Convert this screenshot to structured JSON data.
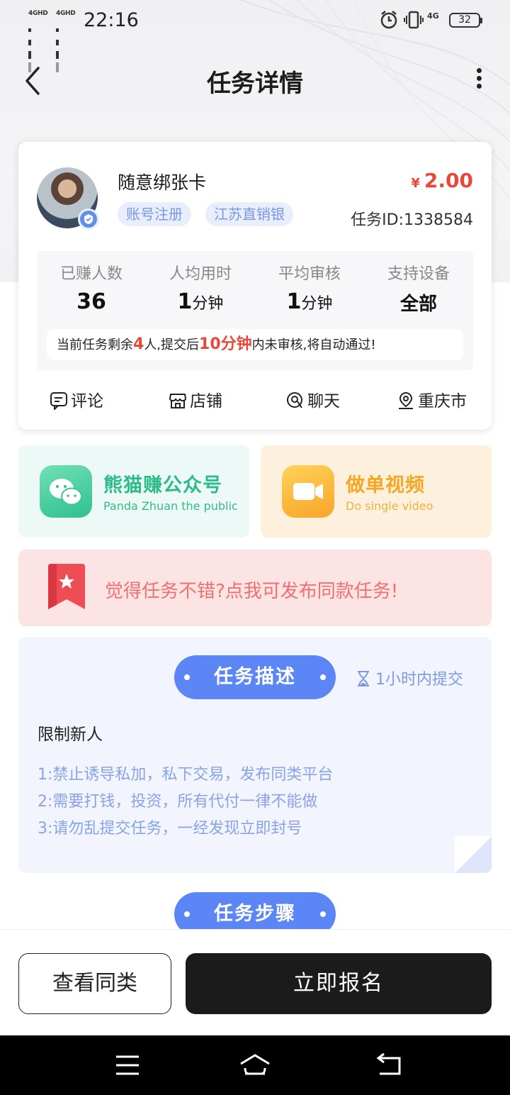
{
  "status_bar": {
    "signal_1": "4GHD",
    "signal_2": "4GHD",
    "time": "22:16",
    "network_label": "4G",
    "battery": "32",
    "icons": [
      "alarm-icon",
      "vibrate-icon",
      "network-icon",
      "battery-icon"
    ]
  },
  "nav": {
    "title": "任务详情",
    "back_icon": "back-arrow-icon",
    "more_icon": "more-vertical-icon"
  },
  "task": {
    "title": "随意绑张卡",
    "tags": [
      "账号注册",
      "江苏直销银"
    ],
    "currency": "¥",
    "price": "2.00",
    "id_label": "任务ID:1338584"
  },
  "stats": [
    {
      "label": "已赚人数",
      "value": "36",
      "unit": ""
    },
    {
      "label": "人均用时",
      "value": "1",
      "unit": "分钟"
    },
    {
      "label": "平均审核",
      "value": "1",
      "unit": "分钟"
    },
    {
      "label": "支持设备",
      "value": "全部",
      "unit": ""
    }
  ],
  "notice": {
    "part1": "当前任务剩余",
    "remaining": "4",
    "part2": "人,提交后",
    "review_time": "10分钟",
    "part3": "内未审核,将自动通过!"
  },
  "actions": [
    {
      "label": "评论",
      "icon": "comment-icon"
    },
    {
      "label": "店铺",
      "icon": "shop-icon"
    },
    {
      "label": "聊天",
      "icon": "chat-icon"
    },
    {
      "label": "重庆市",
      "icon": "location-icon"
    }
  ],
  "promos": {
    "panda": {
      "title": "熊猫赚公众号",
      "subtitle": "Panda Zhuan the public",
      "icon": "wechat-icon"
    },
    "video": {
      "title": "做单视频",
      "subtitle": "Do single video",
      "icon": "video-camera-icon"
    }
  },
  "publish_banner": {
    "text": "觉得任务不错?点我可发布同款任务!",
    "icon": "bookmark-star-icon"
  },
  "description": {
    "header": "任务描述",
    "deadline": "1小时内提交",
    "limit": "限制新人",
    "rules": [
      "1:禁止诱导私加，私下交易，发布同类平台",
      "2:需要打钱，投资，所有代付一律不能做",
      "3:请勿乱提交任务，一经发现立即封号"
    ]
  },
  "steps": {
    "header": "任务步骤"
  },
  "bottom": {
    "similar": "查看同类",
    "signup": "立即报名"
  },
  "system_nav": {
    "icons": [
      "menu-icon",
      "home-icon",
      "back-icon"
    ]
  },
  "colors": {
    "accent_blue": "#5c86f6",
    "price_red": "#e8483a",
    "green": "#2dbb8b",
    "orange": "#f5a623",
    "pink_bg": "#fde4e4",
    "dark_button": "#1b1b1b"
  }
}
